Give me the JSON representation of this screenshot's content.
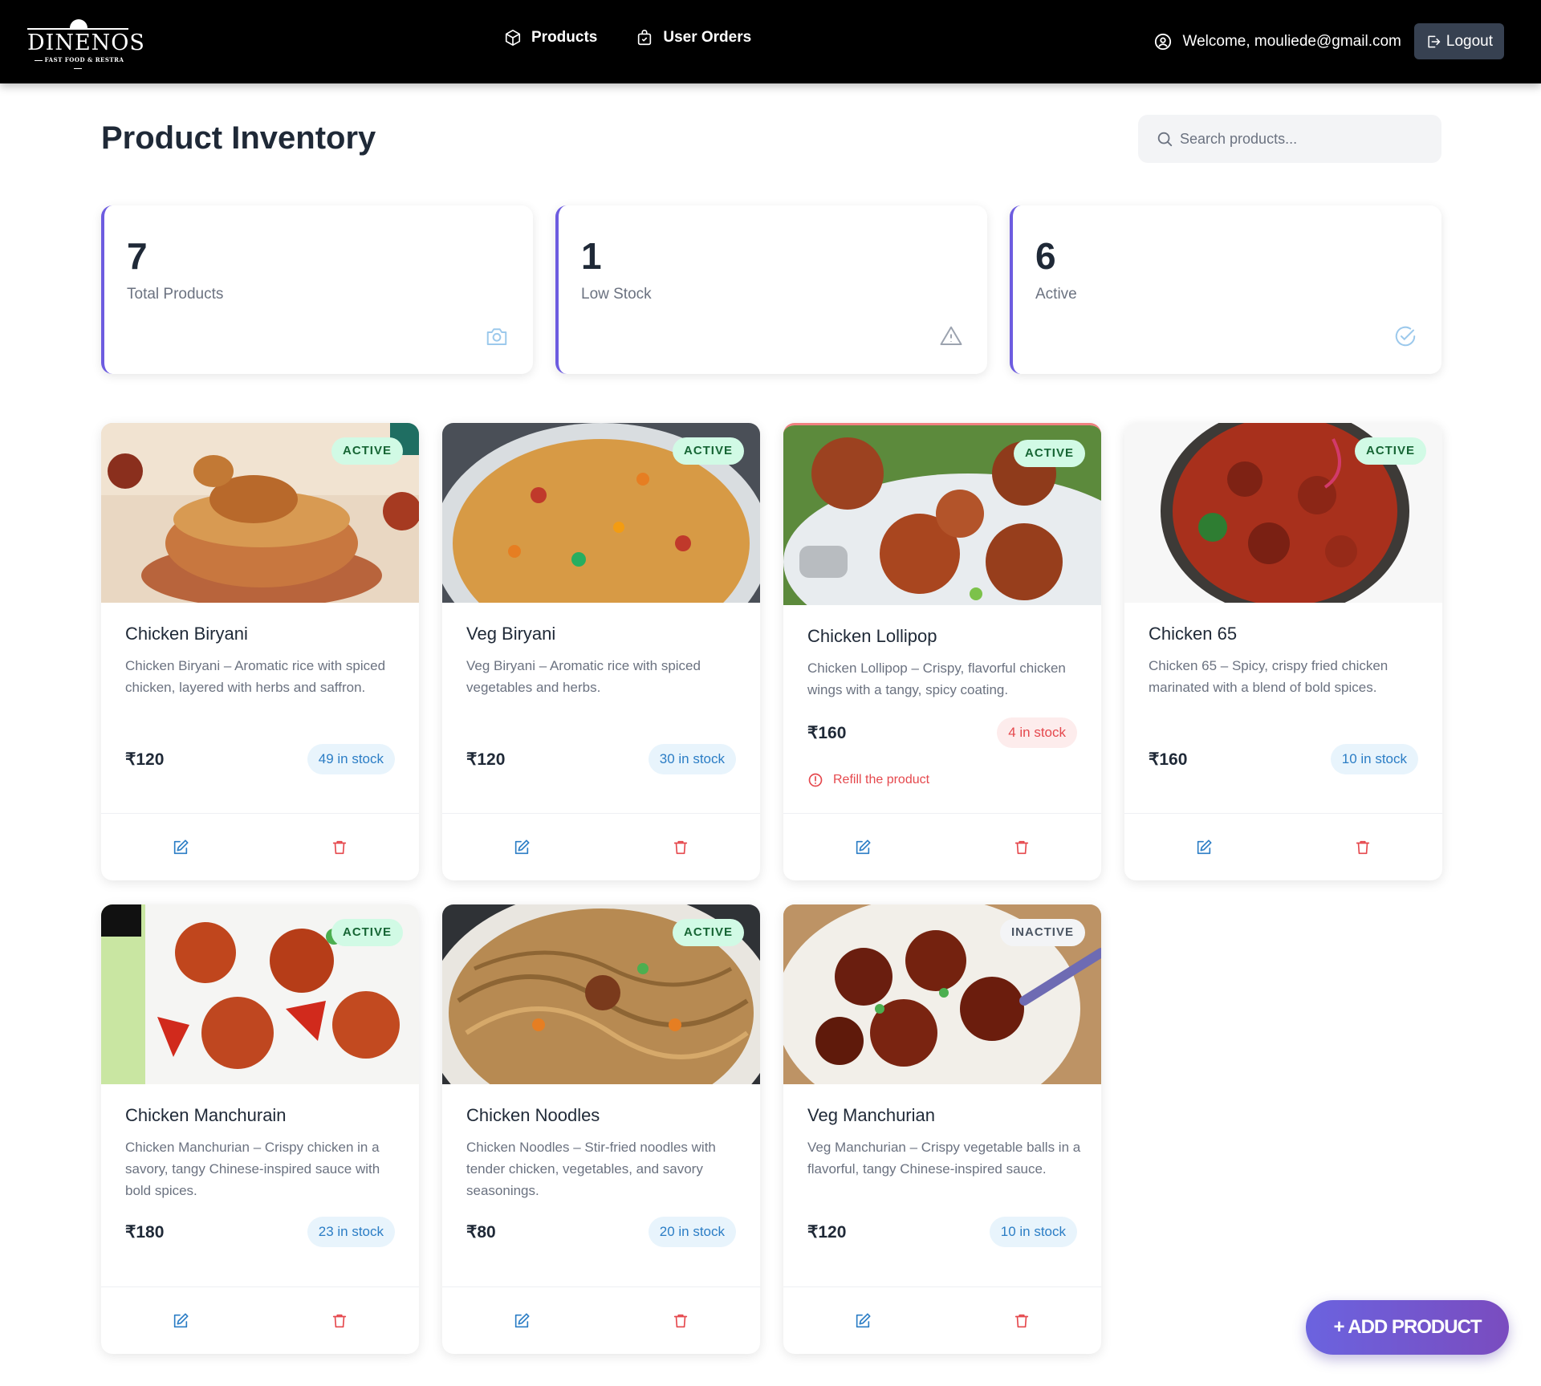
{
  "nav": {
    "logo_name": "DINENOS",
    "logo_tagline": "FAST FOOD & RESTRA",
    "links": [
      {
        "label": "Products",
        "icon": "box-icon"
      },
      {
        "label": "User Orders",
        "icon": "shopping-bag-icon"
      }
    ],
    "welcome": "Welcome, mouliede@gmail.com",
    "logout_label": "Logout"
  },
  "header": {
    "title": "Product Inventory",
    "search_placeholder": "Search products..."
  },
  "stats": [
    {
      "value": "7",
      "label": "Total Products",
      "icon": "camera-icon"
    },
    {
      "value": "1",
      "label": "Low Stock",
      "icon": "warning-triangle-icon"
    },
    {
      "value": "6",
      "label": "Active",
      "icon": "check-circle-icon"
    }
  ],
  "products": [
    {
      "name": "Chicken Biryani",
      "description": "Chicken Biryani – Aromatic rice with spiced chicken, layered with herbs and saffron.",
      "price": "₹120",
      "stock": "49 in stock",
      "status": "ACTIVE",
      "low_stock": false
    },
    {
      "name": "Veg Biryani",
      "description": "Veg Biryani – Aromatic rice with spiced vegetables and herbs.",
      "price": "₹120",
      "stock": "30 in stock",
      "status": "ACTIVE",
      "low_stock": false
    },
    {
      "name": "Chicken Lollipop",
      "description": "Chicken Lollipop – Crispy, flavorful chicken wings with a tangy, spicy coating.",
      "price": "₹160",
      "stock": "4 in stock",
      "status": "ACTIVE",
      "low_stock": true,
      "alert": "Refill the product"
    },
    {
      "name": "Chicken 65",
      "description": "Chicken 65 – Spicy, crispy fried chicken marinated with a blend of bold spices.",
      "price": "₹160",
      "stock": "10 in stock",
      "status": "ACTIVE",
      "low_stock": false
    },
    {
      "name": "Chicken Manchurain",
      "description": "Chicken Manchurian – Crispy chicken in a savory, tangy Chinese-inspired sauce with bold spices.",
      "price": "₹180",
      "stock": "23 in stock",
      "status": "ACTIVE",
      "low_stock": false
    },
    {
      "name": "Chicken Noodles",
      "description": "Chicken Noodles – Stir-fried noodles with tender chicken, vegetables, and savory seasonings.",
      "price": "₹80",
      "stock": "20 in stock",
      "status": "ACTIVE",
      "low_stock": false
    },
    {
      "name": "Veg Manchurian",
      "description": "Veg Manchurian – Crispy vegetable balls in a flavorful, tangy Chinese-inspired sauce.",
      "price": "₹120",
      "stock": "10 in stock",
      "status": "INACTIVE",
      "low_stock": false
    }
  ],
  "fab_label": "+ ADD PRODUCT",
  "colors": {
    "accent": "#6d5ce0",
    "active_badge_bg": "#d1fae5",
    "stock_ok": "#2b7dc5",
    "stock_low": "#e5484d",
    "delete": "#e5484d"
  }
}
